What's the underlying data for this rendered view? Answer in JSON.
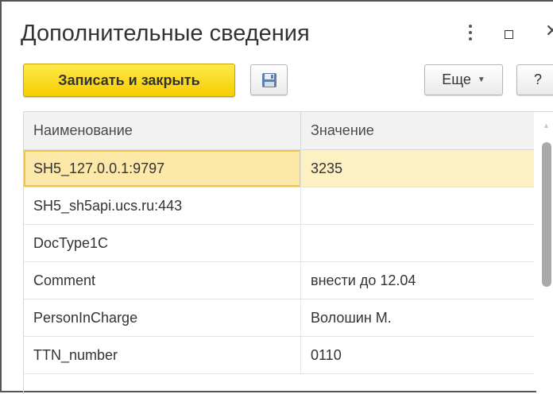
{
  "window": {
    "title": "Дополнительные сведения"
  },
  "toolbar": {
    "save_close_label": "Записать и закрыть",
    "more_label": "Еще",
    "help_label": "?"
  },
  "table": {
    "columns": [
      "Наименование",
      "Значение"
    ],
    "rows": [
      {
        "name": "SH5_127.0.0.1:9797",
        "value": "3235"
      },
      {
        "name": "SH5_sh5api.ucs.ru:443",
        "value": ""
      },
      {
        "name": "DocType1C",
        "value": ""
      },
      {
        "name": "Comment",
        "value": "внести до 12.04"
      },
      {
        "name": "PersonInCharge",
        "value": "Волошин М."
      },
      {
        "name": "TTN_number",
        "value": "0110"
      }
    ],
    "selected_row": 0
  },
  "colors": {
    "primary_button": "#f5ce00",
    "selected_row": "#fdf0c2"
  }
}
